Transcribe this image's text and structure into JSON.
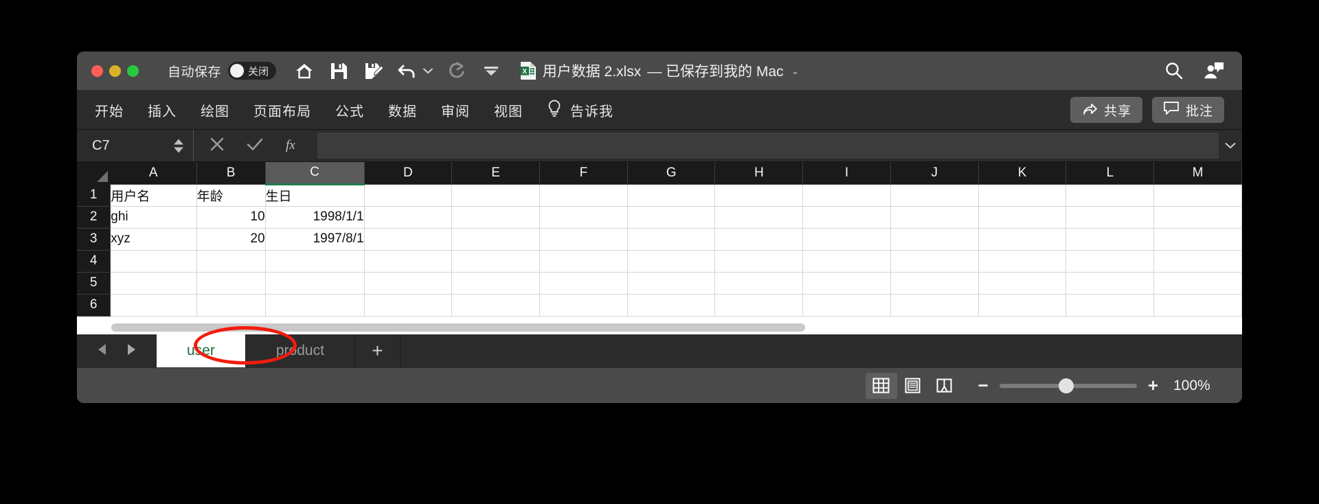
{
  "window": {
    "traffic_lights": [
      "close",
      "minimize",
      "zoom"
    ],
    "autosave": {
      "label": "自动保存",
      "state": "关闭"
    },
    "quick_access": [
      {
        "name": "home-icon"
      },
      {
        "name": "save-icon"
      },
      {
        "name": "save-as-icon"
      },
      {
        "name": "undo-icon"
      },
      {
        "name": "undo-dropdown-caret-icon"
      },
      {
        "name": "redo-icon"
      },
      {
        "name": "customize-toolbar-caret-icon"
      }
    ],
    "title": "用户数据 2.xlsx",
    "title_status": "— 已保存到我的 Mac",
    "title_caret": "⌄",
    "right_icons": [
      {
        "name": "search-icon"
      },
      {
        "name": "account-comment-icon"
      }
    ]
  },
  "ribbon": {
    "tabs": [
      "开始",
      "插入",
      "绘图",
      "页面布局",
      "公式",
      "数据",
      "审阅",
      "视图"
    ],
    "tell_me": "告诉我",
    "share_label": "共享",
    "comment_label": "批注"
  },
  "formula_bar": {
    "name_box": "C7",
    "cancel_label": "×",
    "confirm_label": "✓",
    "fx_label": "fx",
    "formula_value": "",
    "expand_caret": "⌄"
  },
  "sheet": {
    "columns": [
      "A",
      "B",
      "C",
      "D",
      "E",
      "F",
      "G",
      "H",
      "I",
      "J",
      "K",
      "L",
      "M"
    ],
    "selected_column": "C",
    "rows": [
      "1",
      "2",
      "3",
      "4",
      "5",
      "6"
    ],
    "cells": [
      {
        "A": "用户名",
        "B": "年龄",
        "C": "生日",
        "align": {
          "A": "txt",
          "B": "txt",
          "C": "txt"
        }
      },
      {
        "A": "ghi",
        "B": "10",
        "C": "1998/1/1",
        "align": {
          "A": "txt",
          "B": "num",
          "C": "num"
        }
      },
      {
        "A": "xyz",
        "B": "20",
        "C": "1997/8/1",
        "align": {
          "A": "txt",
          "B": "num",
          "C": "num"
        }
      },
      {
        "A": "",
        "B": "",
        "C": "",
        "align": {
          "A": "txt",
          "B": "txt",
          "C": "txt"
        }
      },
      {
        "A": "",
        "B": "",
        "C": "",
        "align": {
          "A": "txt",
          "B": "txt",
          "C": "txt"
        }
      },
      {
        "A": "",
        "B": "",
        "C": "",
        "align": {
          "A": "txt",
          "B": "txt",
          "C": "txt"
        }
      }
    ]
  },
  "sheet_tabs": {
    "prev_label": "◀",
    "next_label": "▶",
    "tabs": [
      {
        "label": "user",
        "active": true,
        "annotated": true
      },
      {
        "label": "product",
        "active": false,
        "annotated": false
      }
    ],
    "add_label": "+"
  },
  "status_bar": {
    "views": [
      {
        "name": "normal-view-icon",
        "active": true
      },
      {
        "name": "page-layout-view-icon",
        "active": false
      },
      {
        "name": "page-break-view-icon",
        "active": false
      }
    ],
    "zoom_out": "−",
    "zoom_in": "+",
    "zoom_percent": "100%"
  },
  "colors": {
    "accent_green": "#1c6b3c",
    "annotation_red": "#f21c0d",
    "titlebar_bg": "#4a4a4a",
    "ribbon_bg": "#2b2b2b",
    "header_bg": "#1a1a1a"
  }
}
